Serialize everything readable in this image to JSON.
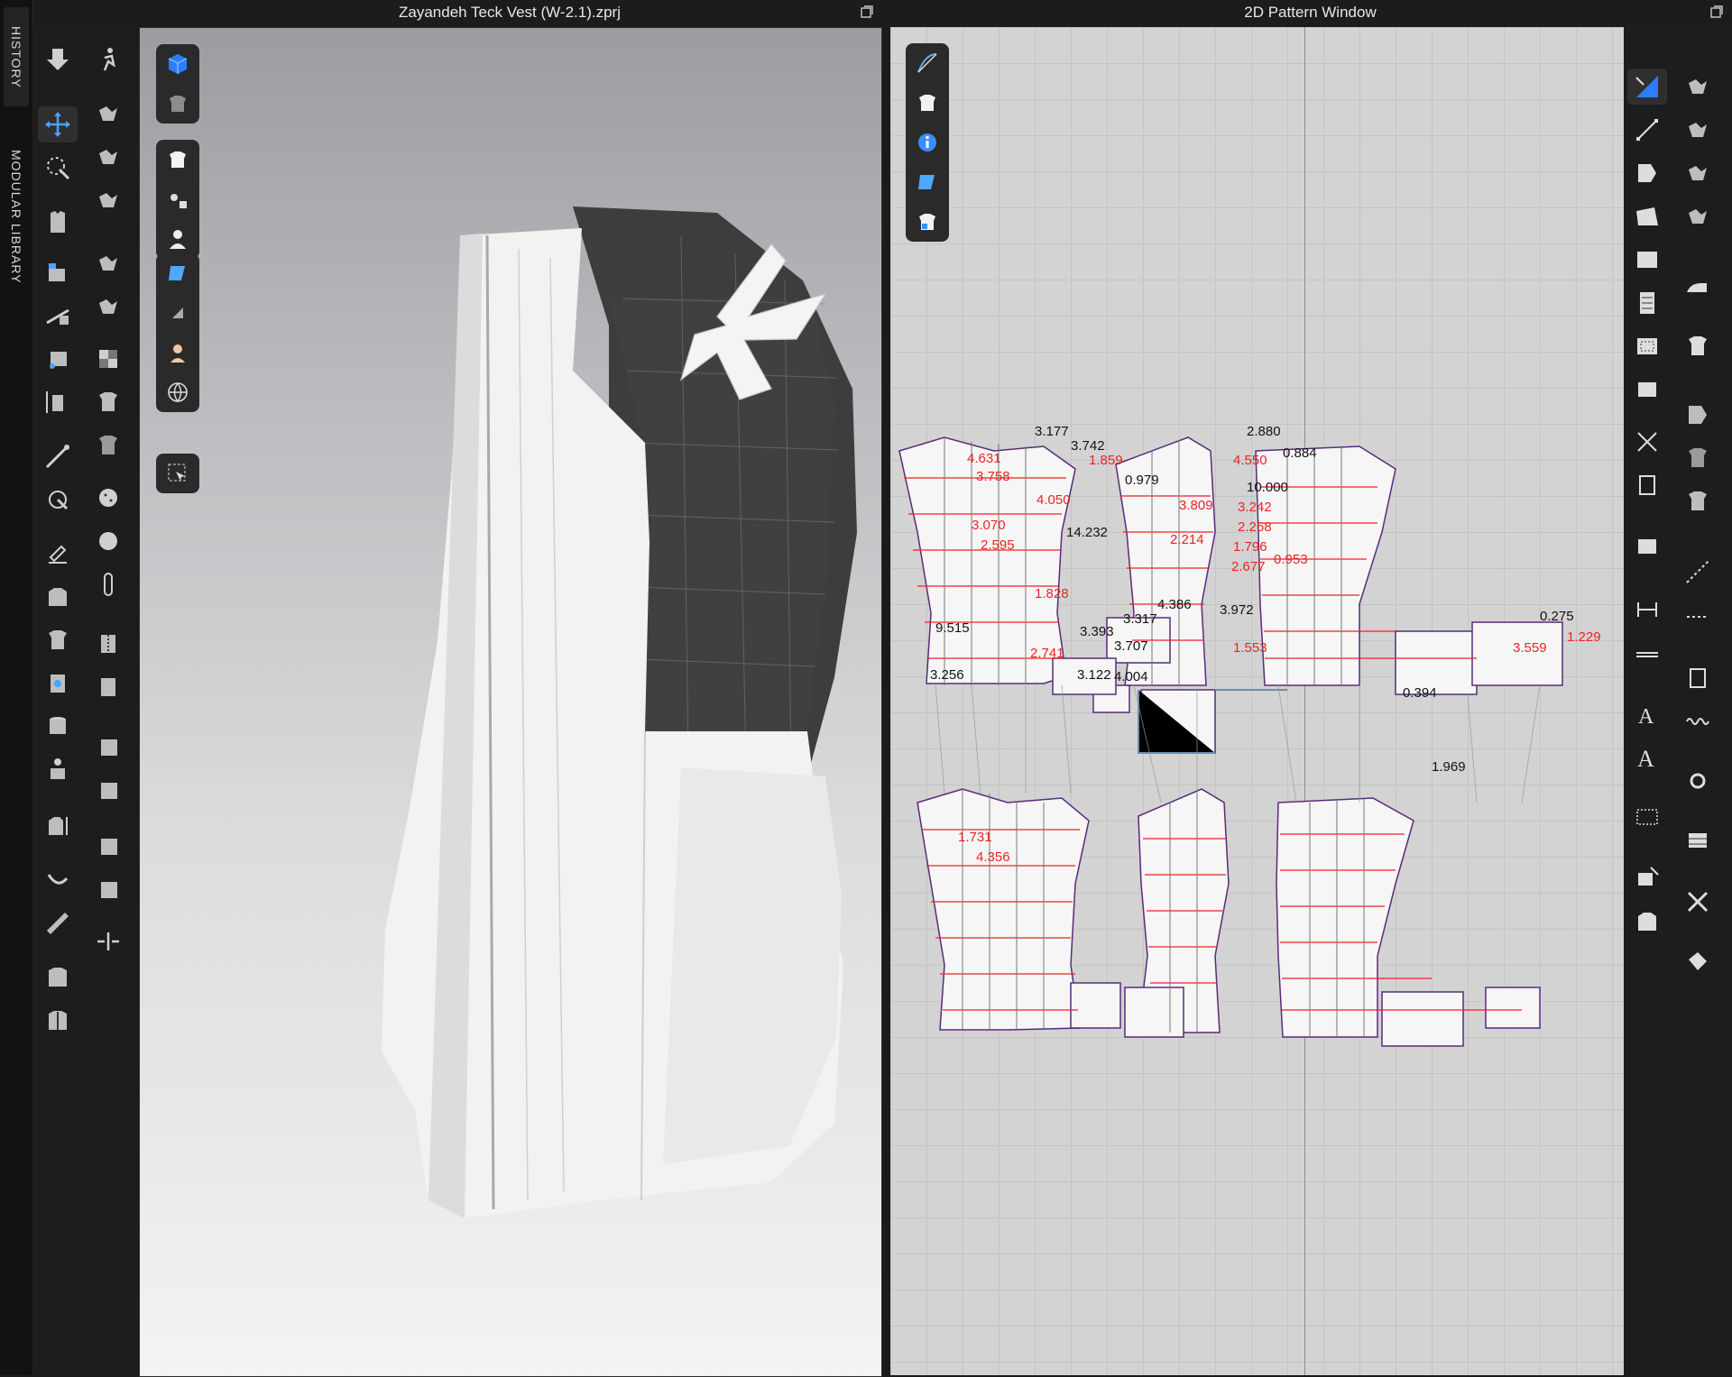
{
  "side_tabs": {
    "history": "HISTORY",
    "modular_library": "MODULAR LIBRARY"
  },
  "window_3d": {
    "title": "Zayandeh Teck Vest (W-2.1).zprj"
  },
  "window_2d": {
    "title": "2D Pattern Window"
  },
  "pattern_measurements_black": [
    "3.177",
    "3.742",
    "2.880",
    "4.550",
    "10.000",
    "14.232",
    "3.972",
    "4.386",
    "0.394",
    "1.969",
    "3.256",
    "3.122",
    "4.004",
    "0.275",
    "3.707",
    "3.393",
    "3.317",
    "9.515",
    "0.979",
    "0.884"
  ],
  "pattern_measurements_red": [
    "4.631",
    "3.758",
    "3.070",
    "2.595",
    "1.859",
    "3.242",
    "2.268",
    "1.796",
    "4.050",
    "1.828",
    "2.741",
    "3.559",
    "0.953",
    "2.677",
    "1.553",
    "3.809",
    "2.214",
    "1.229",
    "1.731",
    "4.356"
  ]
}
